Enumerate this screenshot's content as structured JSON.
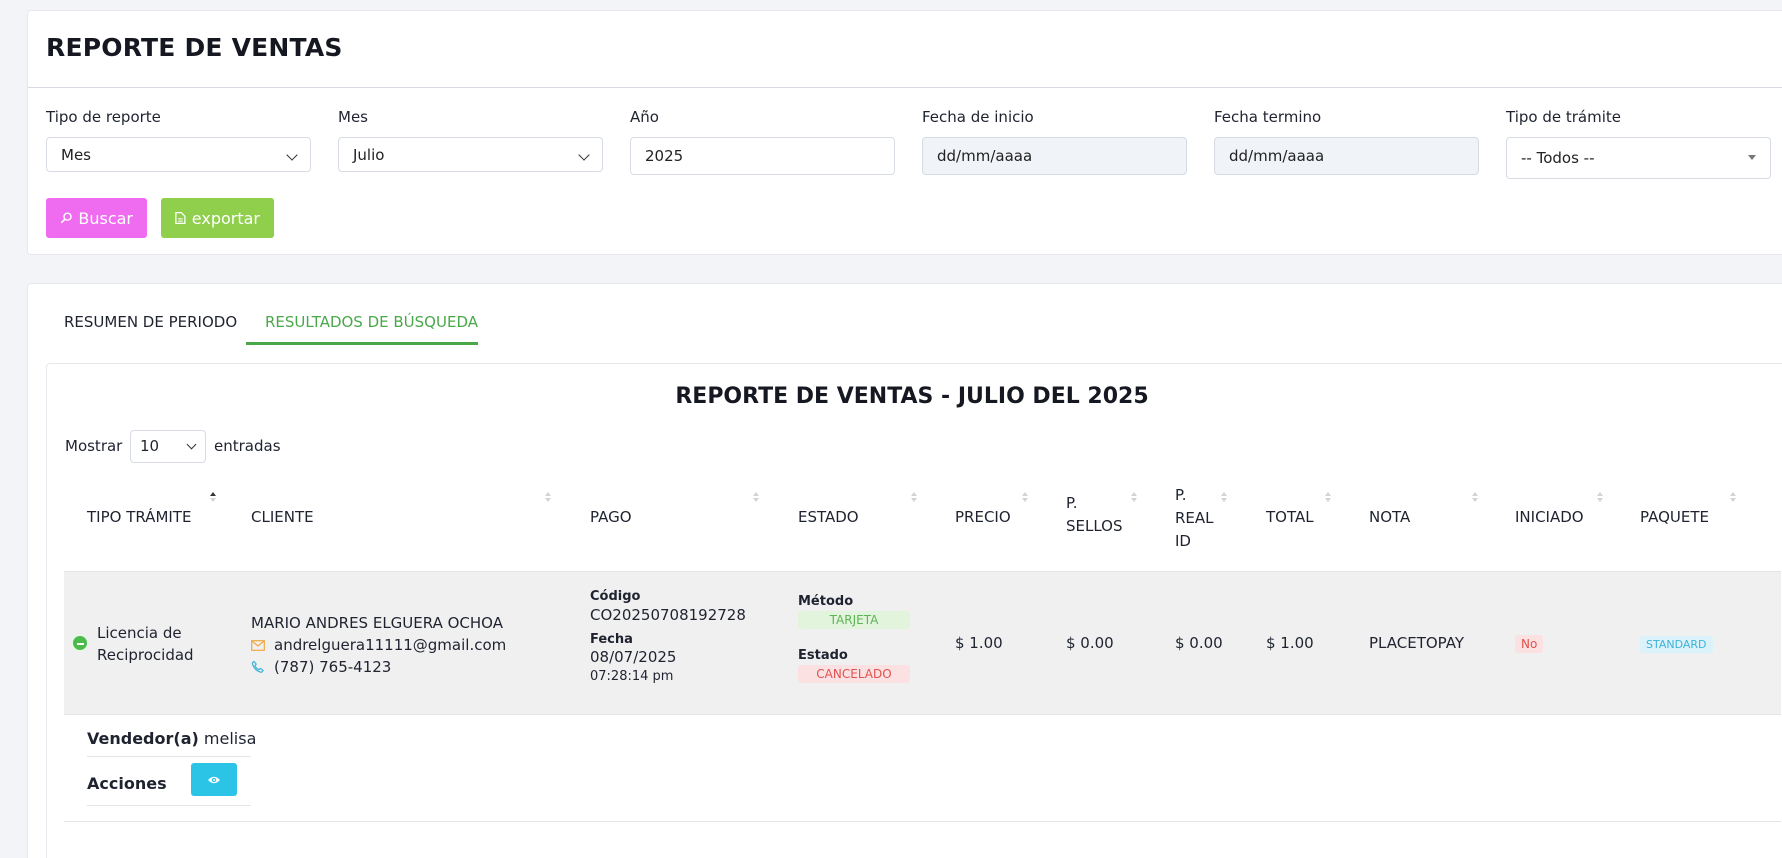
{
  "page": {
    "title": "REPORTE DE VENTAS"
  },
  "filters": {
    "tipo_reporte": {
      "label": "Tipo de reporte",
      "value": "Mes"
    },
    "mes": {
      "label": "Mes",
      "value": "Julio"
    },
    "anio": {
      "label": "Año",
      "value": "2025"
    },
    "fecha_inicio": {
      "label": "Fecha de inicio",
      "placeholder": "dd/mm/aaaa"
    },
    "fecha_termino": {
      "label": "Fecha termino",
      "placeholder": "dd/mm/aaaa"
    },
    "tipo_tramite": {
      "label": "Tipo de trámite",
      "value": "-- Todos --"
    }
  },
  "buttons": {
    "buscar": "Buscar",
    "exportar": "exportar"
  },
  "tabs": [
    {
      "label": "RESUMEN DE PERIODO",
      "active": false
    },
    {
      "label": "RESULTADOS DE BÚSQUEDA",
      "active": true
    }
  ],
  "report": {
    "title": "REPORTE DE VENTAS - JULIO DEL 2025",
    "show_label": "Mostrar",
    "show_value": "10",
    "entries_label": "entradas"
  },
  "table": {
    "headers": [
      "TIPO TRÁMITE",
      "CLIENTE",
      "PAGO",
      "ESTADO",
      "PRECIO",
      "P. SELLOS",
      "P. REAL ID",
      "TOTAL",
      "NOTA",
      "INICIADO",
      "PAQUETE"
    ],
    "header_lines": {
      "p_sellos": [
        "P.",
        "SELLOS"
      ],
      "p_real_id": [
        "P.",
        "REAL",
        "ID"
      ]
    },
    "rows": [
      {
        "tipo_tramite": [
          "Licencia de",
          "Reciprocidad"
        ],
        "cliente_nombre": "MARIO ANDRES ELGUERA OCHOA",
        "cliente_email": "andrelguera11111@gmail.com",
        "cliente_telefono": "(787) 765-4123",
        "pago_codigo_label": "Código",
        "pago_codigo": "CO20250708192728",
        "pago_fecha_label": "Fecha",
        "pago_fecha": "08/07/2025",
        "pago_hora": "07:28:14 pm",
        "metodo_label": "Método",
        "metodo": "TARJETA",
        "estado_label": "Estado",
        "estado": "CANCELADO",
        "precio": "$ 1.00",
        "p_sellos": "$ 0.00",
        "p_real_id": "$ 0.00",
        "total": "$ 1.00",
        "nota": "PLACETOPAY",
        "iniciado": "No",
        "paquete": "STANDARD"
      }
    ]
  },
  "detail": {
    "vendedor_label": "Vendedor(a)",
    "vendedor": "melisa",
    "acciones_label": "Acciones"
  },
  "colors": {
    "buscar": "#ef6bef",
    "exportar": "#8fcf4c",
    "active_tab": "#4aa84a",
    "view_button": "#2bc4e6"
  }
}
